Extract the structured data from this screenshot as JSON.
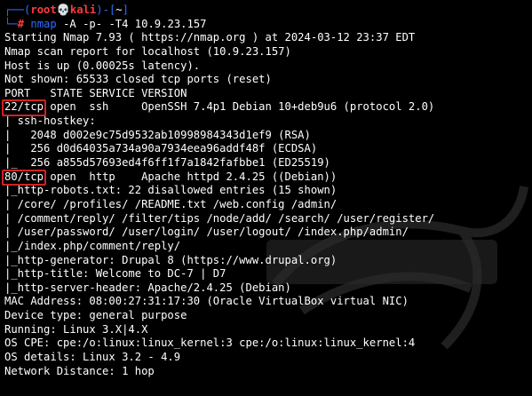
{
  "prompt": {
    "top_left": "┌──(",
    "user": "root",
    "skull": "💀",
    "host": "kali",
    "bracket_close": ")-[",
    "cwd": "~",
    "bracket_end": "]",
    "bottom_left": "└─",
    "hash": "#",
    "command_name": "nmap",
    "command_args": "-A -p- -T4 10.9.23.157"
  },
  "output": [
    "Starting Nmap 7.93 ( https://nmap.org ) at 2024-03-12 23:37 EDT",
    "Nmap scan report for localhost (10.9.23.157)",
    "Host is up (0.00025s latency).",
    "Not shown: 65533 closed tcp ports (reset)",
    "PORT   STATE SERVICE VERSION",
    "22/tcp open  ssh     OpenSSH 7.4p1 Debian 10+deb9u6 (protocol 2.0)",
    "| ssh-hostkey:",
    "|   2048 d002e9c75d9532ab10998984343d1ef9 (RSA)",
    "|   256 d0d64035a734a90a7934eea96addf48f (ECDSA)",
    "|_  256 a855d57693ed4f6ff1f7a1842fafbbe1 (ED25519)",
    "80/tcp open  http    Apache httpd 2.4.25 ((Debian))",
    "|_http-robots.txt: 22 disallowed entries (15 shown)",
    "| /core/ /profiles/ /README.txt /web.config /admin/",
    "| /comment/reply/ /filter/tips /node/add/ /search/ /user/register/",
    "| /user/password/ /user/login/ /user/logout/ /index.php/admin/",
    "|_/index.php/comment/reply/",
    "|_http-generator: Drupal 8 (https://www.drupal.org)",
    "|_http-title: Welcome to DC-7 | D7",
    "|_http-server-header: Apache/2.4.25 (Debian)",
    "MAC Address: 08:00:27:31:17:30 (Oracle VirtualBox virtual NIC)",
    "Device type: general purpose",
    "Running: Linux 3.X|4.X",
    "OS CPE: cpe:/o:linux:linux_kernel:3 cpe:/o:linux:linux_kernel:4",
    "OS details: Linux 3.2 - 4.9",
    "Network Distance: 1 hop"
  ],
  "highlights": [
    "22/tcp",
    "80/tcp"
  ],
  "colors": {
    "background": "#000000",
    "text": "#ffffff",
    "prompt_frame": "#2f6dff",
    "prompt_user_host": "#ff3b3b",
    "highlight_box": "#d22222"
  }
}
